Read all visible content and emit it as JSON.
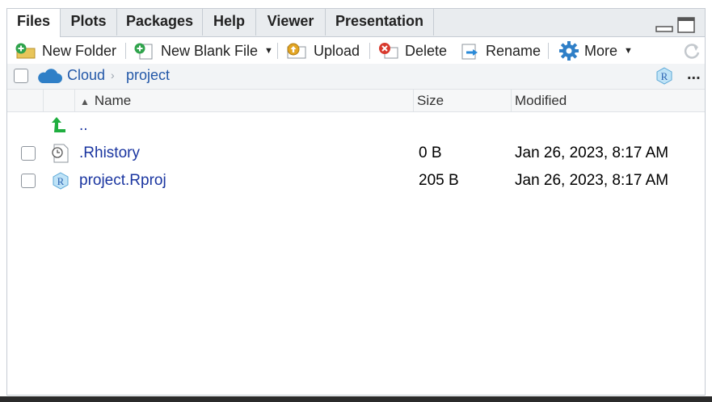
{
  "tabs": [
    {
      "label": "Files",
      "active": true
    },
    {
      "label": "Plots",
      "active": false
    },
    {
      "label": "Packages",
      "active": false
    },
    {
      "label": "Help",
      "active": false
    },
    {
      "label": "Viewer",
      "active": false
    },
    {
      "label": "Presentation",
      "active": false
    }
  ],
  "toolbar": {
    "new_folder": "New Folder",
    "new_blank_file": "New Blank File",
    "upload": "Upload",
    "delete": "Delete",
    "rename": "Rename",
    "more": "More",
    "overflow": "..."
  },
  "breadcrumb": {
    "root": "Cloud",
    "current": "project",
    "separator": "›"
  },
  "table": {
    "columns": {
      "name": "Name",
      "size": "Size",
      "modified": "Modified"
    },
    "sort": {
      "column": "Name",
      "direction": "ascending"
    },
    "parent_label": "..",
    "rows": [
      {
        "name": ".Rhistory",
        "icon": "history-file-icon",
        "size": "0 B",
        "modified": "Jan 26, 2023, 8:17 AM"
      },
      {
        "name": "project.Rproj",
        "icon": "rproj-file-icon",
        "size": "205 B",
        "modified": "Jan 26, 2023, 8:17 AM"
      }
    ]
  },
  "colors": {
    "link": "#1a35a0",
    "breadcrumb": "#2358a8",
    "tab_bar": "#e9ecef",
    "up_arrow": "#1fae3f"
  }
}
